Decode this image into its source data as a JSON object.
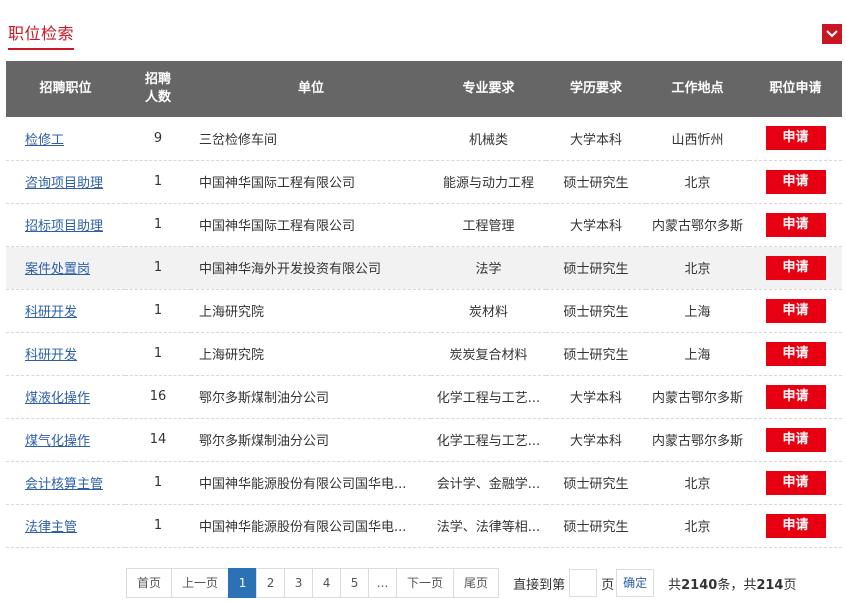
{
  "section": {
    "title": "职位检索"
  },
  "table": {
    "headers": {
      "position": "招聘职位",
      "count_line1": "招聘",
      "count_line2": "人数",
      "unit": "单位",
      "major": "专业要求",
      "education": "学历要求",
      "location": "工作地点",
      "apply": "职位申请"
    },
    "apply_label": "申请",
    "rows": [
      {
        "position": "检修工",
        "count": "9",
        "unit": "三岔检修车间",
        "major": "机械类",
        "education": "大学本科",
        "location": "山西忻州"
      },
      {
        "position": "咨询项目助理",
        "count": "1",
        "unit": "中国神华国际工程有限公司",
        "major": "能源与动力工程",
        "education": "硕士研究生",
        "location": "北京"
      },
      {
        "position": "招标项目助理",
        "count": "1",
        "unit": "中国神华国际工程有限公司",
        "major": "工程管理",
        "education": "大学本科",
        "location": "内蒙古鄂尔多斯"
      },
      {
        "position": "案件处置岗",
        "count": "1",
        "unit": "中国神华海外开发投资有限公司",
        "major": "法学",
        "education": "硕士研究生",
        "location": "北京"
      },
      {
        "position": "科研开发",
        "count": "1",
        "unit": "上海研究院",
        "major": "炭材料",
        "education": "硕士研究生",
        "location": "上海"
      },
      {
        "position": "科研开发",
        "count": "1",
        "unit": "上海研究院",
        "major": "炭炭复合材料",
        "education": "硕士研究生",
        "location": "上海"
      },
      {
        "position": "煤液化操作",
        "count": "16",
        "unit": "鄂尔多斯煤制油分公司",
        "major": "化学工程与工艺...",
        "education": "大学本科",
        "location": "内蒙古鄂尔多斯"
      },
      {
        "position": "煤气化操作",
        "count": "14",
        "unit": "鄂尔多斯煤制油分公司",
        "major": "化学工程与工艺...",
        "education": "大学本科",
        "location": "内蒙古鄂尔多斯"
      },
      {
        "position": "会计核算主管",
        "count": "1",
        "unit": "中国神华能源股份有限公司国华电...",
        "major": "会计学、金融学...",
        "education": "硕士研究生",
        "location": "北京"
      },
      {
        "position": "法律主管",
        "count": "1",
        "unit": "中国神华能源股份有限公司国华电...",
        "major": "法学、法律等相...",
        "education": "硕士研究生",
        "location": "北京"
      }
    ]
  },
  "pagination": {
    "first": "首页",
    "prev": "上一页",
    "pages": [
      "1",
      "2",
      "3",
      "4",
      "5"
    ],
    "current": "1",
    "ellipsis": "...",
    "next": "下一页",
    "last": "尾页",
    "jump_prefix": "直接到第",
    "jump_suffix": "页",
    "jump_value": "",
    "confirm": "确定",
    "total_prefix": "共",
    "total_records": "2140",
    "total_mid": "条，共",
    "total_pages": "214",
    "total_suffix": "页"
  },
  "colors": {
    "accent": "#c81623",
    "apply_button": "#e60012",
    "header_bg": "#666666",
    "link": "#2c5fa8",
    "active_page": "#2a72b5"
  },
  "icons": {
    "collapse": "chevron-down-icon"
  }
}
